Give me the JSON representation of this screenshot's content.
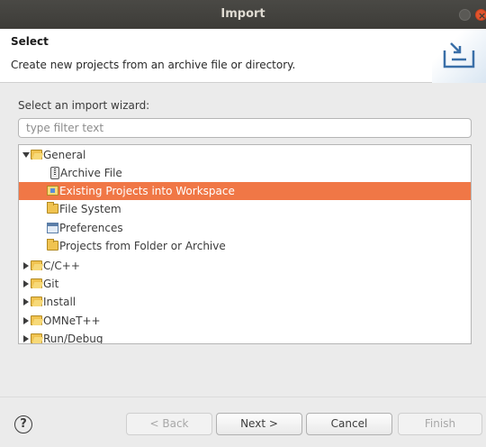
{
  "window": {
    "title": "Import"
  },
  "header": {
    "title": "Select",
    "description": "Create new projects from an archive file or directory."
  },
  "wizard": {
    "label": "Select an import wizard:",
    "filter_placeholder": "type filter text"
  },
  "tree": {
    "items": [
      {
        "label": "General",
        "expanded": true,
        "icon": "folder-open-icon"
      },
      {
        "label": "Archive File",
        "icon": "archive-icon"
      },
      {
        "label": "Existing Projects into Workspace",
        "icon": "project-icon",
        "selected": true
      },
      {
        "label": "File System",
        "icon": "folder-icon"
      },
      {
        "label": "Preferences",
        "icon": "preferences-icon"
      },
      {
        "label": "Projects from Folder or Archive",
        "icon": "folder-icon"
      },
      {
        "label": "C/C++",
        "expanded": false,
        "icon": "folder-open-icon"
      },
      {
        "label": "Git",
        "expanded": false,
        "icon": "folder-open-icon"
      },
      {
        "label": "Install",
        "expanded": false,
        "icon": "folder-open-icon"
      },
      {
        "label": "OMNeT++",
        "expanded": false,
        "icon": "folder-open-icon"
      },
      {
        "label": "Run/Debug",
        "expanded": false,
        "icon": "folder-open-icon"
      }
    ]
  },
  "footer": {
    "help": "?",
    "back_label": "< Back",
    "next_label": "Next >",
    "cancel_label": "Cancel",
    "finish_label": "Finish"
  },
  "colors": {
    "selection": "#f07746",
    "titlebar": "#3d3c38"
  }
}
